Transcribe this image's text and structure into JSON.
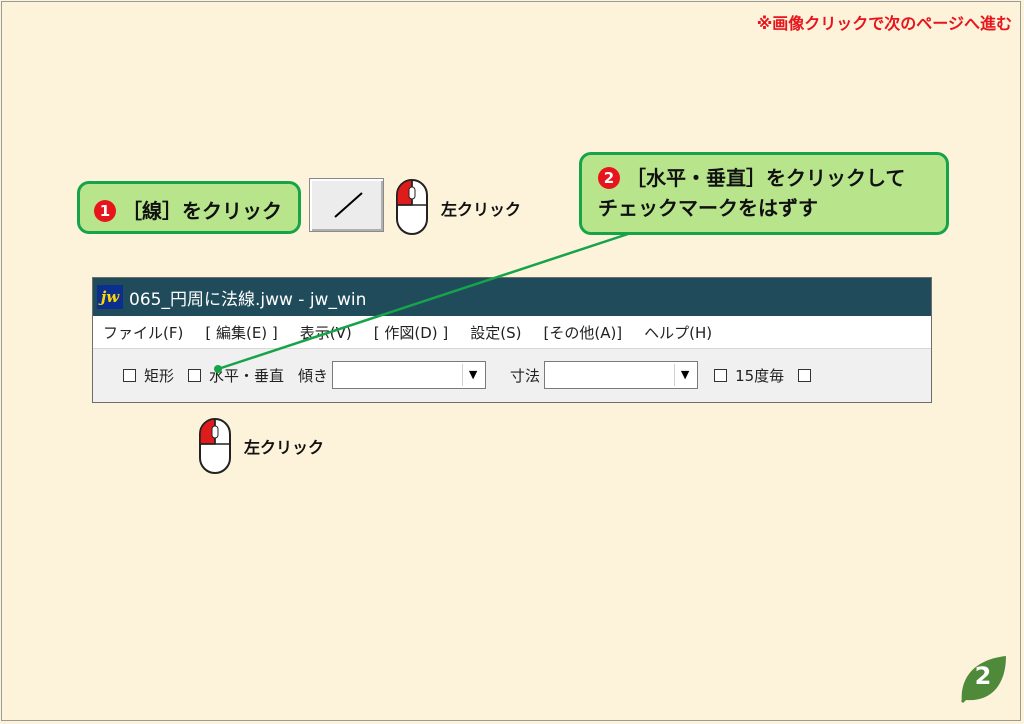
{
  "top_note": "※画像クリックで次のページへ進む",
  "callouts": {
    "step1": {
      "number": "❶",
      "text": "［線］をクリック"
    },
    "step2": {
      "number": "❷",
      "line1": "［水平・垂直］をクリックして",
      "line2": "チェックマークをはずす"
    }
  },
  "mouse_labels": {
    "first": "左クリック",
    "second": "左クリック"
  },
  "window": {
    "logo": "jw",
    "title": "065_円周に法線.jww - jw_win",
    "menu": [
      "ファイル(F)",
      "[ 編集(E) ]",
      "表示(V)",
      "[ 作図(D) ]",
      "設定(S)",
      "[その他(A)]",
      "ヘルプ(H)"
    ],
    "toolbar": {
      "rect_label": "矩形",
      "hv_label": "水平・垂直",
      "tilt_label": "傾き",
      "tilt_value": "",
      "dim_label": "寸法",
      "dim_value": "",
      "deg15_label": "15度毎"
    }
  },
  "page_number": "2",
  "colors": {
    "background": "#fdf3da",
    "callout_fill": "#b8e58c",
    "callout_border": "#16a34a",
    "accent_red": "#e8141c",
    "titlebar": "#1f4b5a"
  }
}
